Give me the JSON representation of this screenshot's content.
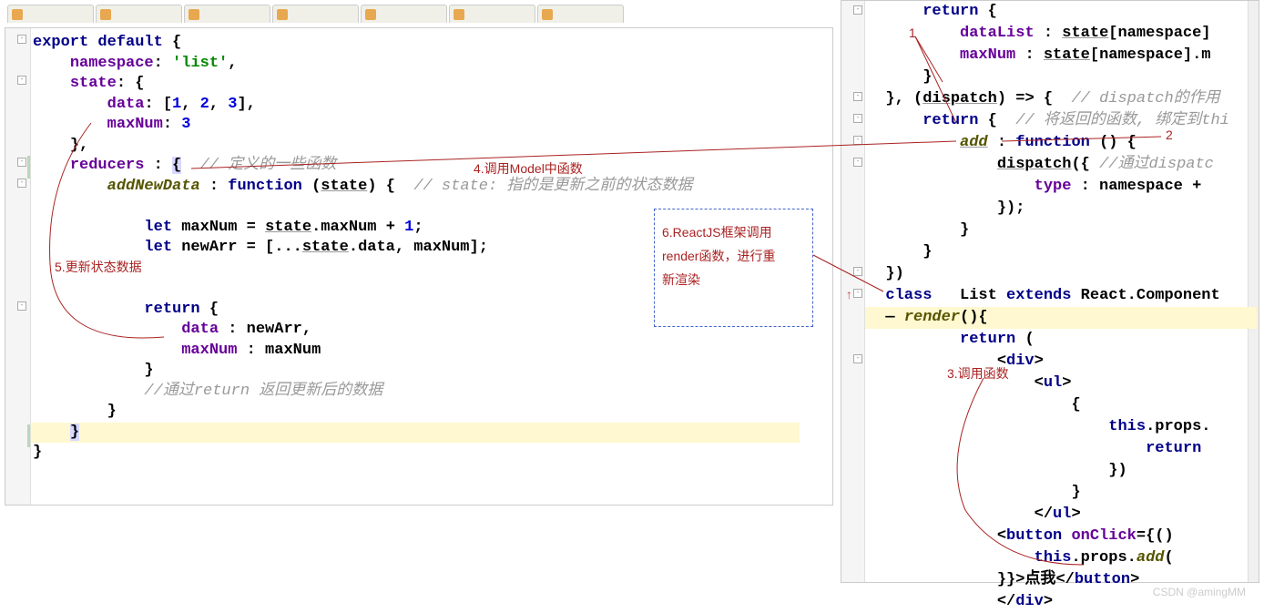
{
  "leftCode": {
    "line1_kw1": "export",
    "line1_kw2": "default",
    "line1_rest": " {",
    "line2_prop": "namespace",
    "line2_colon": ": ",
    "line2_str": "'list'",
    "line2_comma": ",",
    "line3_prop": "state",
    "line3_colon": ": ",
    "line3_brace": "{",
    "line4_prop": "data",
    "line4_colon": ": [",
    "line4_n1": "1",
    "line4_c1": ", ",
    "line4_n2": "2",
    "line4_c2": ", ",
    "line4_n3": "3",
    "line4_rest": "],",
    "line5_prop": "maxNum",
    "line5_colon": ": ",
    "line5_n": "3",
    "line6": "},",
    "line7_prop": "reducers",
    "line7_colon": " : ",
    "line7_brace": "{",
    "line7_comment": "  // 定义的一些函数",
    "line8_fn": "addNewData",
    "line8_colon": " : ",
    "line8_kw": "function",
    "line8_paren": " (",
    "line8_arg": "state",
    "line8_close": ") {  ",
    "line8_comment": "// state: 指的是更新之前的状态数据",
    "line9_kw": "let",
    "line9_var": " maxNum = ",
    "line9_state": "state",
    "line9_rest": ".maxNum + ",
    "line9_n": "1",
    "line9_semi": ";",
    "line10_kw": "let",
    "line10_var": " newArr = [...",
    "line10_state": "state",
    "line10_rest": ".data, maxNum];",
    "line11_kw": "return",
    "line11_rest": " {",
    "line12_prop": "data",
    "line12_rest": " : newArr,",
    "line13_prop": "maxNum",
    "line13_rest": " : maxNum",
    "line14": "}",
    "line15_comment": "//通过return 返回更新后的数据",
    "line16": "}",
    "line17": "}",
    "line18": "}"
  },
  "rightCode": {
    "r1_kw": "return",
    "r1_rest": " {",
    "r2_prop": "dataList",
    "r2_colon": " : ",
    "r2_state": "state",
    "r2_rest": "[namespace]",
    "r3_prop": "maxNum",
    "r3_colon": " : ",
    "r3_state": "state",
    "r3_rest": "[namespace].m",
    "r4": "}",
    "r5_a": "}, (",
    "r5_disp": "dispatch",
    "r5_b": ") => {  ",
    "r5_comment": "// dispatch的作用",
    "r6_kw": "return",
    "r6_rest": " {  ",
    "r6_comment": "// 将返回的函数, 绑定到thi",
    "r7_fn": "add",
    "r7_colon": " : ",
    "r7_kw": "function",
    "r7_rest": " () {",
    "r8_fn": "dispatch",
    "r8_rest": "({ ",
    "r8_comment": "//通过dispatc",
    "r9_prop": "type",
    "r9_rest": " : namespace + ",
    "r10": "});",
    "r11": "}",
    "r12": "}",
    "r13": "})",
    "r14_kw": "class",
    "r14_sp": "   ",
    "r14_name": "List ",
    "r14_ext": "extends",
    "r14_rest": " React.Component",
    "r15_fn": "render",
    "r15_rest": "(){",
    "r16_kw": "return",
    "r16_rest": " (",
    "r17": "<",
    "r17_tag": "div",
    "r17_close": ">",
    "r18": "<",
    "r18_tag": "ul",
    "r18_close": ">",
    "r19": "{",
    "r20_kw": "this",
    "r20_rest": ".props.",
    "r21_kw": "return",
    "r21_rest": " ",
    "r22": "})",
    "r23": "}",
    "r24": "</",
    "r24_tag": "ul",
    "r24_close": ">",
    "r25": "<",
    "r25_tag": "button",
    "r25_sp": " ",
    "r25_attr": "onClick",
    "r25_eq": "=",
    "r25_val": "{()",
    "r26_kw": "this",
    "r26_rest": ".props.",
    "r26_fn": "add",
    "r26_paren": "(",
    "r27_a": "}}>",
    "r27_txt": "点我",
    "r27_b": "</",
    "r27_tag": "button",
    "r27_close": ">",
    "r28": "</",
    "r28_tag": "div",
    "r28_close": ">"
  },
  "annotations": {
    "a1": "1",
    "a2": "2",
    "a3": "3.调用函数",
    "a4": "4.调用Model中函数",
    "a5": "5.更新状态数据",
    "a6a": "6.ReactJS框架调用",
    "a6b": "render函数，进行重",
    "a6c": "新渲染"
  },
  "watermark": "CSDN @amingMM"
}
